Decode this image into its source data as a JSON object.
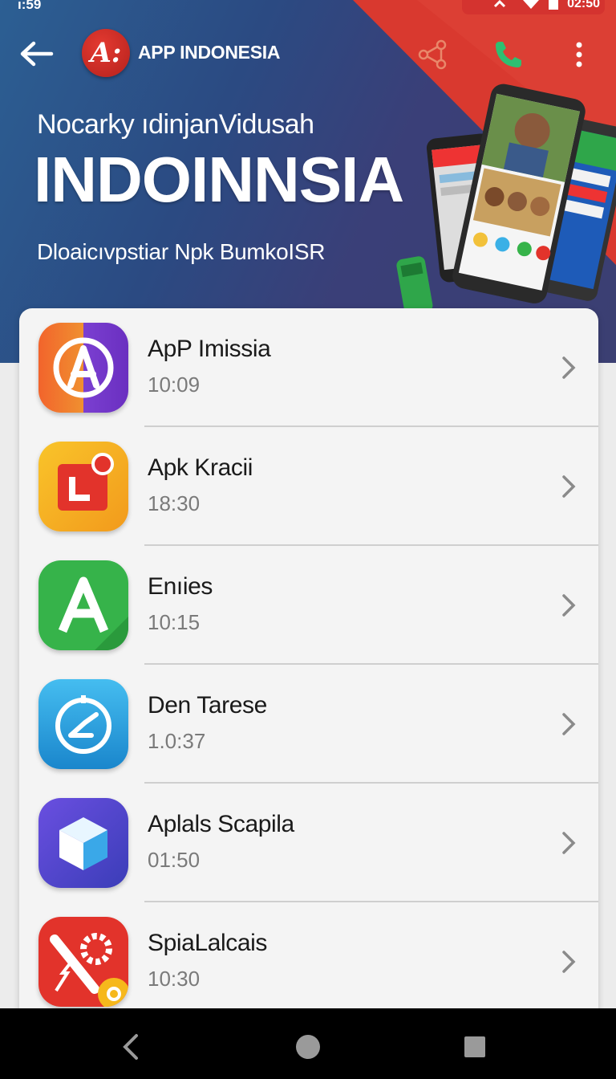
{
  "status_bar": {
    "time_left": "ı:59",
    "time_right": "02:50"
  },
  "app_bar": {
    "logo_text": "A:",
    "title": "APP INDONESIA"
  },
  "hero": {
    "subtitle": "Nocarky ıdinjanVidusah",
    "title": "INDOINNSIA",
    "tagline": "Dloaicıvpstiar Npk BumkoISR"
  },
  "colors": {
    "accent_red": "#d4332f",
    "hero_blue": "#2c5f93",
    "call_green": "#2fbf71"
  },
  "apps": [
    {
      "name": "ApP Imissia",
      "time": "10:09",
      "icon": "compass-a-icon",
      "colors": [
        "#f2642c",
        "#7b3fd1"
      ]
    },
    {
      "name": "Apk Kracii",
      "time": "18:30",
      "icon": "photo-box-icon",
      "colors": [
        "#f6b81c",
        "#e2332b"
      ]
    },
    {
      "name": "Enıies",
      "time": "10:15",
      "icon": "letter-a-icon",
      "colors": [
        "#36b34a",
        "#1e8f37"
      ]
    },
    {
      "name": "Den Tarese",
      "time": "1.0:37",
      "icon": "clock-check-icon",
      "colors": [
        "#3ab0e6",
        "#1a82c9"
      ]
    },
    {
      "name": "Aplals Scapila",
      "time": "01:50",
      "icon": "cube-icon",
      "colors": [
        "#5a4fd8",
        "#3b3db8"
      ]
    },
    {
      "name": "SpiaLalcais",
      "time": "10:30",
      "icon": "gear-tools-icon",
      "colors": [
        "#e2332b",
        "#b81f1b"
      ]
    }
  ],
  "navigation": {
    "back": "back-icon",
    "home": "home-icon",
    "recents": "recents-icon"
  }
}
